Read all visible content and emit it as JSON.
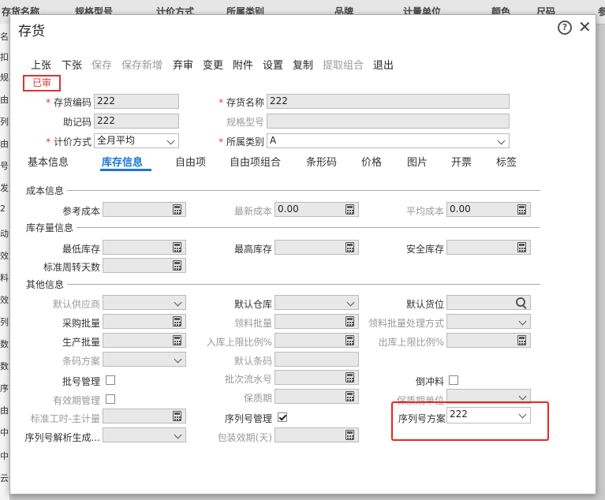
{
  "background": {
    "columns": [
      "存货名称",
      "规格型号",
      "计价方式",
      "所属类别",
      "品牌",
      "计量单位",
      "颜色",
      "尺码",
      "参"
    ],
    "left_cells": [
      "名",
      "扣",
      "规",
      "由",
      "列",
      "由",
      "号",
      "发",
      "2",
      "动",
      "效",
      "料",
      "效",
      "列",
      "数",
      "数",
      "序",
      "由",
      "中",
      "中",
      "云"
    ]
  },
  "dialog": {
    "title": "存货",
    "help_glyph": "?",
    "close_glyph": "✕"
  },
  "toolbar": {
    "prev": "上张",
    "next": "下张",
    "save": "保存",
    "save_new": "保存新增",
    "abandon": "弃审",
    "change": "变更",
    "attach": "附件",
    "settings": "设置",
    "copy": "复制",
    "extract": "提取组合",
    "exit": "退出"
  },
  "status": "已审",
  "header": {
    "req": "*",
    "code_label": "存货编码",
    "code_value": "222",
    "name_label": "存货名称",
    "name_value": "222",
    "mnemonic_label": "助记码",
    "mnemonic_value": "222",
    "spec_label": "规格型号",
    "spec_value": "",
    "pricing_label": "计价方式",
    "pricing_value": "全月平均",
    "category_label": "所属类别",
    "category_value": "A"
  },
  "tabs": [
    "基本信息",
    "库存信息",
    "自由项",
    "自由项组合",
    "条形码",
    "价格",
    "图片",
    "开票",
    "标签"
  ],
  "cost": {
    "section": "成本信息",
    "ref_label": "参考成本",
    "ref_value": "",
    "latest_label": "最新成本",
    "latest_value": "0.00",
    "avg_label": "平均成本",
    "avg_value": "0.00"
  },
  "stock": {
    "section": "库存量信息",
    "min_label": "最低库存",
    "max_label": "最高库存",
    "safe_label": "安全库存",
    "turnover_label": "标准周转天数"
  },
  "other": {
    "section": "其他信息",
    "supplier_label": "默认供应商",
    "warehouse_label": "默认仓库",
    "location_label": "默认货位",
    "purchase_batch_label": "采购批量",
    "pick_batch_label": "领料批量",
    "pick_batch_method_label": "领料批量处理方式",
    "production_batch_label": "生产批量",
    "in_limit_label": "入库上限比例%",
    "out_limit_label": "出库上限比例%",
    "barcode_scheme_label": "条码方案",
    "default_barcode_label": "默认条码",
    "batch_mgmt_label": "批号管理",
    "batch_serial_label": "批次流水号",
    "backflush_label": "倒冲料",
    "expiry_mgmt_label": "有效期管理",
    "shelf_life_label": "保质期",
    "shelf_unit_label": "保质期单位",
    "std_hours_label": "标准工时-主计量",
    "serial_mgmt_label": "序列号管理",
    "serial_scheme_label": "序列号方案",
    "serial_scheme_value": "222",
    "serial_parse_label": "序列号解析生成...",
    "pack_life_label": "包装效期(天)"
  }
}
